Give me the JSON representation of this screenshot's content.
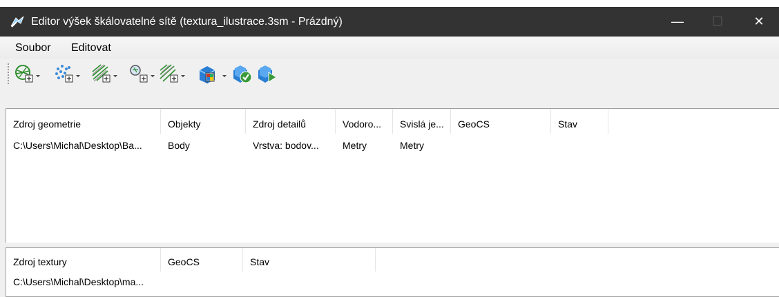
{
  "window": {
    "title": "Editor výšek škálovatelné sítě (textura_ilustrace.3sm - Prázdný)",
    "minimize_glyph": "—",
    "maximize_glyph": "☐",
    "close_glyph": "✕"
  },
  "menu": {
    "items": [
      "Soubor",
      "Editovat"
    ]
  },
  "toolbar": {
    "buttons": [
      {
        "icon": "add-mesh-icon",
        "dropdown": true
      },
      {
        "icon": "add-points-icon",
        "dropdown": true
      },
      {
        "icon": "add-lines-icon",
        "dropdown": true
      },
      {
        "icon": "add-search-icon",
        "dropdown": true
      },
      {
        "icon": "add-texture-icon",
        "dropdown": true
      },
      {
        "icon": "cube-blue-icon",
        "dropdown": true
      },
      {
        "icon": "validate-icon",
        "dropdown": false
      },
      {
        "icon": "run-icon",
        "dropdown": false
      }
    ]
  },
  "geometry_table": {
    "columns": [
      "Zdroj geometrie",
      "Objekty",
      "Zdroj detailů",
      "Vodoro...",
      "Svislá je...",
      "GeoCS",
      "Stav"
    ],
    "rows": [
      [
        "C:\\Users\\Michal\\Desktop\\Ba...",
        "Body",
        "Vrstva: bodov...",
        "Metry",
        "Metry",
        "",
        ""
      ]
    ]
  },
  "texture_table": {
    "columns": [
      "Zdroj textury",
      "GeoCS",
      "Stav"
    ],
    "rows": [
      [
        "C:\\Users\\Michal\\Desktop\\ma...",
        "",
        ""
      ]
    ]
  },
  "colors": {
    "titlebar": "#333333",
    "background": "#f0f0f0",
    "panel": "#ffffff",
    "icon_green": "#3a9a3a",
    "icon_blue": "#2a7fd4"
  }
}
